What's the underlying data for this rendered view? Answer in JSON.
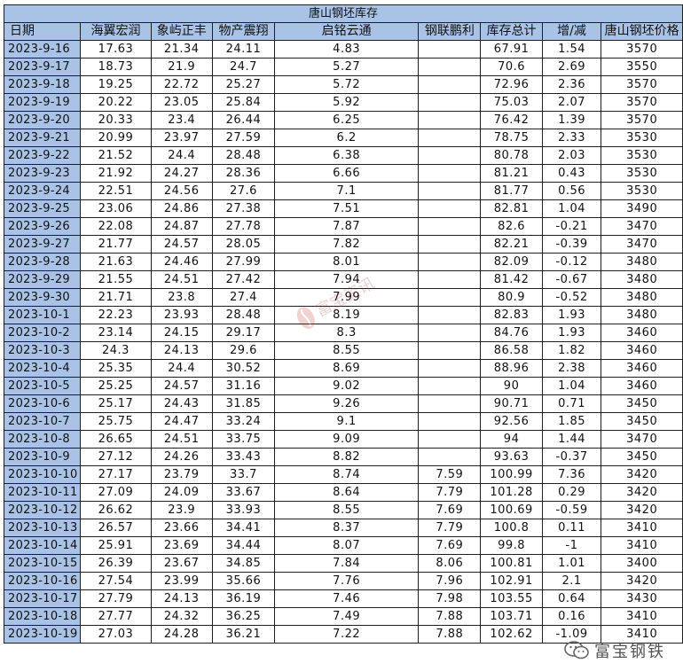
{
  "title": "唐山钢坯库存",
  "headers": [
    "日期",
    "海翼宏润",
    "象屿正丰",
    "物产震翔",
    "启铭云通",
    "钢联鹏利",
    "库存总计",
    "增/减",
    "唐山钢坯价格"
  ],
  "rows": [
    [
      "2023-9-16",
      "17.63",
      "21.34",
      "24.11",
      "4.83",
      "",
      "67.91",
      "1.54",
      "3570"
    ],
    [
      "2023-9-17",
      "18.73",
      "21.9",
      "24.7",
      "5.27",
      "",
      "70.6",
      "2.69",
      "3550"
    ],
    [
      "2023-9-18",
      "19.25",
      "22.72",
      "25.27",
      "5.72",
      "",
      "72.96",
      "2.36",
      "3570"
    ],
    [
      "2023-9-19",
      "20.22",
      "23.05",
      "25.84",
      "5.92",
      "",
      "75.03",
      "2.07",
      "3570"
    ],
    [
      "2023-9-20",
      "20.33",
      "23.4",
      "26.44",
      "6.25",
      "",
      "76.42",
      "1.39",
      "3570"
    ],
    [
      "2023-9-21",
      "20.99",
      "23.97",
      "27.59",
      "6.2",
      "",
      "78.75",
      "2.33",
      "3530"
    ],
    [
      "2023-9-22",
      "21.52",
      "24.4",
      "28.48",
      "6.38",
      "",
      "80.78",
      "2.03",
      "3530"
    ],
    [
      "2023-9-23",
      "21.92",
      "24.27",
      "28.36",
      "6.66",
      "",
      "81.21",
      "0.43",
      "3530"
    ],
    [
      "2023-9-24",
      "22.51",
      "24.56",
      "27.6",
      "7.1",
      "",
      "81.77",
      "0.56",
      "3530"
    ],
    [
      "2023-9-25",
      "23.06",
      "24.86",
      "27.38",
      "7.51",
      "",
      "82.81",
      "1.04",
      "3490"
    ],
    [
      "2023-9-26",
      "22.08",
      "24.87",
      "27.78",
      "7.87",
      "",
      "82.6",
      "-0.21",
      "3470"
    ],
    [
      "2023-9-27",
      "21.77",
      "24.57",
      "28.05",
      "7.82",
      "",
      "82.21",
      "-0.39",
      "3470"
    ],
    [
      "2023-9-28",
      "21.63",
      "24.46",
      "27.99",
      "8.01",
      "",
      "82.09",
      "-0.12",
      "3480"
    ],
    [
      "2023-9-29",
      "21.55",
      "24.51",
      "27.42",
      "7.94",
      "",
      "81.42",
      "-0.67",
      "3480"
    ],
    [
      "2023-9-30",
      "21.71",
      "23.8",
      "27.4",
      "7.99",
      "",
      "80.9",
      "-0.52",
      "3480"
    ],
    [
      "2023-10-1",
      "22.23",
      "23.93",
      "28.48",
      "8.19",
      "",
      "82.83",
      "1.93",
      "3480"
    ],
    [
      "2023-10-2",
      "23.14",
      "24.15",
      "29.17",
      "8.3",
      "",
      "84.76",
      "1.93",
      "3460"
    ],
    [
      "2023-10-3",
      "24.3",
      "24.13",
      "29.6",
      "8.55",
      "",
      "86.58",
      "1.82",
      "3460"
    ],
    [
      "2023-10-4",
      "25.35",
      "24.4",
      "30.52",
      "8.69",
      "",
      "88.96",
      "2.38",
      "3460"
    ],
    [
      "2023-10-5",
      "25.25",
      "24.57",
      "31.16",
      "9.02",
      "",
      "90",
      "1.04",
      "3460"
    ],
    [
      "2023-10-6",
      "25.17",
      "24.43",
      "31.85",
      "9.26",
      "",
      "90.71",
      "0.71",
      "3450"
    ],
    [
      "2023-10-7",
      "25.75",
      "24.47",
      "33.24",
      "9.1",
      "",
      "92.56",
      "1.85",
      "3450"
    ],
    [
      "2023-10-8",
      "26.65",
      "24.51",
      "33.75",
      "9.09",
      "",
      "94",
      "1.44",
      "3470"
    ],
    [
      "2023-10-9",
      "27.12",
      "24.26",
      "33.43",
      "8.82",
      "",
      "93.63",
      "-0.37",
      "3450"
    ],
    [
      "2023-10-10",
      "27.17",
      "23.79",
      "33.7",
      "8.74",
      "7.59",
      "100.99",
      "7.36",
      "3420"
    ],
    [
      "2023-10-11",
      "27.09",
      "24.09",
      "33.67",
      "8.64",
      "7.79",
      "101.28",
      "0.29",
      "3420"
    ],
    [
      "2023-10-12",
      "26.62",
      "23.9",
      "33.93",
      "8.55",
      "7.69",
      "100.69",
      "-0.59",
      "3420"
    ],
    [
      "2023-10-13",
      "26.57",
      "23.66",
      "34.41",
      "8.37",
      "7.79",
      "100.8",
      "0.11",
      "3410"
    ],
    [
      "2023-10-14",
      "25.91",
      "23.69",
      "34.44",
      "8.07",
      "7.69",
      "99.8",
      "-1",
      "3410"
    ],
    [
      "2023-10-15",
      "26.39",
      "23.67",
      "34.85",
      "7.84",
      "8.06",
      "100.81",
      "1.01",
      "3400"
    ],
    [
      "2023-10-16",
      "27.54",
      "23.99",
      "35.66",
      "7.76",
      "7.96",
      "102.91",
      "2.1",
      "3420"
    ],
    [
      "2023-10-17",
      "27.79",
      "24.13",
      "36.19",
      "7.46",
      "7.98",
      "103.55",
      "0.64",
      "3430"
    ],
    [
      "2023-10-18",
      "27.77",
      "24.32",
      "36.25",
      "7.49",
      "7.88",
      "103.71",
      "0.16",
      "3410"
    ],
    [
      "2023-10-19",
      "27.03",
      "24.28",
      "36.21",
      "7.22",
      "7.88",
      "102.62",
      "-1.09",
      "3410"
    ]
  ],
  "watermark": "富宝资讯",
  "brand": {
    "text": "富宝钢铁",
    "icon": "wechat-icon"
  },
  "colors": {
    "header_bg": "#a9c3e6",
    "increase": "#e8403d",
    "decrease": "#2aa84a"
  }
}
